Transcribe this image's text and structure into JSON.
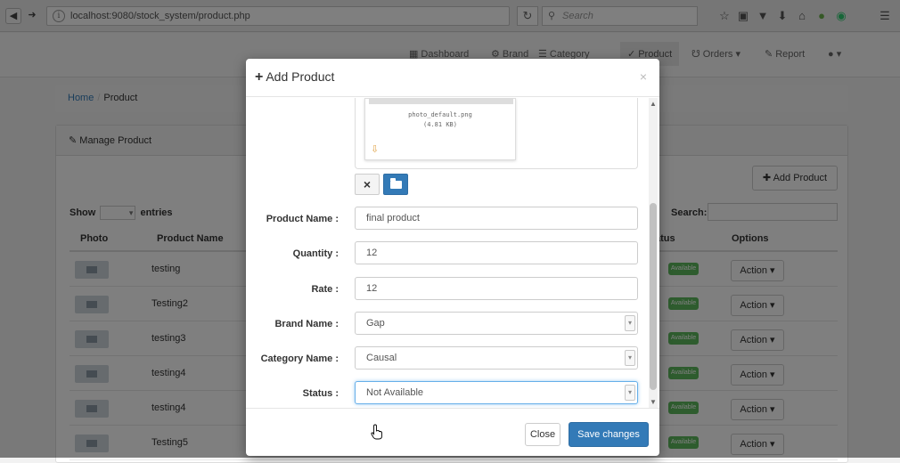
{
  "browser": {
    "url": "localhost:9080/stock_system/product.php",
    "search_placeholder": "Search",
    "icons": [
      "star-icon",
      "clipboard-icon",
      "pocket-icon",
      "download-icon",
      "home-icon",
      "extension-icon",
      "chrome-icon",
      "menu-icon"
    ]
  },
  "appnav": {
    "items": [
      {
        "label": "Dashboard",
        "icon": "dashboard-icon"
      },
      {
        "label": "Brand",
        "icon": "brand-icon"
      },
      {
        "label": "Category",
        "icon": "list-icon"
      },
      {
        "label": "Product",
        "icon": "product-icon",
        "active": true
      },
      {
        "label": "Orders",
        "icon": "cart-icon",
        "dropdown": true
      },
      {
        "label": "Report",
        "icon": "report-icon"
      }
    ]
  },
  "breadcrumb": {
    "home": "Home",
    "current": "Product"
  },
  "panel": {
    "title": "Manage Product",
    "add_button": "Add Product",
    "show_label": "Show",
    "entries_label": "entries",
    "search_label": "Search:",
    "columns": [
      "Photo",
      "Product Name",
      "Status",
      "Options"
    ],
    "rows": [
      {
        "name": "testing",
        "status": "Available",
        "action": "Action"
      },
      {
        "name": "Testing2",
        "status": "Available",
        "action": "Action"
      },
      {
        "name": "testing3",
        "status": "Available",
        "action": "Action"
      },
      {
        "name": "testing4",
        "status": "Available",
        "action": "Action"
      },
      {
        "name": "testing4",
        "status": "Available",
        "action": "Action"
      },
      {
        "name": "Testing5",
        "status": "Available",
        "action": "Action"
      }
    ]
  },
  "modal": {
    "title": "Add Product",
    "close_symbol": "×",
    "preview": {
      "filename": "photo_default.png",
      "filesize": "(4.81 KB)"
    },
    "remove_symbol": "×",
    "fields": {
      "product_name": {
        "label": "Product Name :",
        "value": "final product"
      },
      "quantity": {
        "label": "Quantity :",
        "value": "12"
      },
      "rate": {
        "label": "Rate :",
        "value": "12"
      },
      "brand_name": {
        "label": "Brand Name :",
        "value": "Gap"
      },
      "category_name": {
        "label": "Category Name :",
        "value": "Causal"
      },
      "status": {
        "label": "Status :",
        "value": "Not Available"
      }
    },
    "close_button": "Close",
    "save_button": "Save changes"
  },
  "colors": {
    "primary": "#337ab7",
    "success": "#5cb85c",
    "backdrop": "rgba(0,0,0,0.5)"
  }
}
